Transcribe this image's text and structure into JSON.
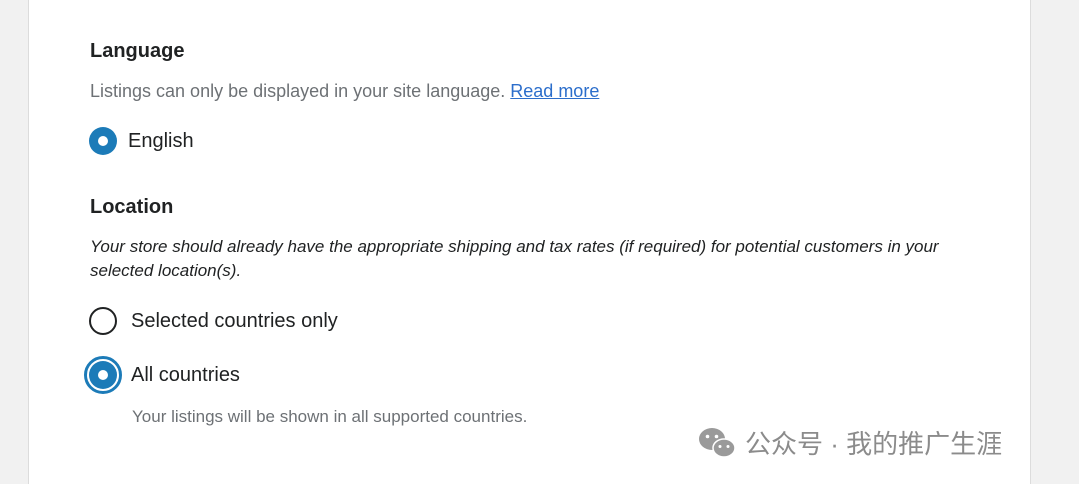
{
  "language": {
    "title": "Language",
    "help_text": "Listings can only be displayed in your site language.",
    "read_more": "Read more",
    "option_label": "English"
  },
  "location": {
    "title": "Location",
    "note": "Your store should already have the appropriate shipping and tax rates (if required) for potential customers in your selected location(s).",
    "options": [
      {
        "label": "Selected countries only",
        "selected": false
      },
      {
        "label": "All countries",
        "selected": true
      }
    ],
    "all_countries_help": "Your listings will be shown in all supported countries."
  },
  "watermark": {
    "text": "公众号 · 我的推广生涯",
    "icon": "wechat-icon"
  },
  "colors": {
    "accent": "#1c7bb8",
    "link": "#2c6ecb",
    "muted_text": "#6d7175"
  }
}
